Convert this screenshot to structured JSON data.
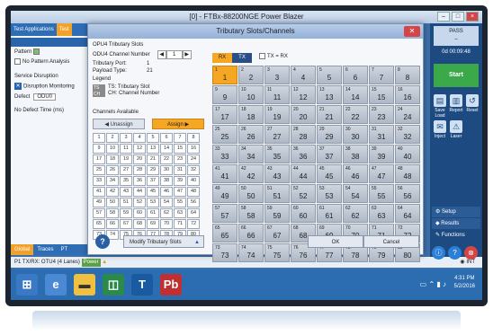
{
  "window_title": "[0] - FTBx-88200NGE Power Blazer",
  "left": {
    "tabs": [
      "Test Applications",
      "Test"
    ],
    "pattern_label": "Pattern",
    "no_pattern": "No Pattern Analysis",
    "service_disruption": "Service Disruption",
    "disruption_monitoring": "Disruption Monitoring",
    "defect_label": "Defect",
    "defect_value": "ODU0",
    "no_defect_time": "No Defect Time (ms)",
    "bottom_tabs": [
      "Global",
      "Traces",
      "PT"
    ]
  },
  "status": {
    "text": "P1 TX/RX: OTU4 (4 Lanes)",
    "power": "Power"
  },
  "right": {
    "pass": "PASS",
    "elapsed": "0d 00:09:48",
    "start": "Start",
    "icons": [
      "Save Load",
      "Report",
      "Reset",
      "Inject",
      "Laser"
    ],
    "menu": [
      "Setup",
      "Results",
      "Functions"
    ]
  },
  "taskbar": {
    "time": "4:31 PM",
    "date": "5/2/2016",
    "int": "INT"
  },
  "dialog": {
    "title": "Tributary Slots/Channels",
    "section": "OPU4 Tributary Slots",
    "odu4_label": "ODU4 Channel Number",
    "odu4_value": "1",
    "trib_port_label": "Tributary Port:",
    "trib_port_value": "1",
    "payload_label": "Payload Type:",
    "payload_value": "21",
    "legend_label": "Legend",
    "legend_ts": "TS: Tributary Slot",
    "legend_ch": "CH: Channel Number",
    "channels_available": "Channels Available",
    "unassign": "Unassign",
    "assign": "Assign",
    "rx_tab": "RX",
    "tx_tab": "TX",
    "tx_rx_label": "TX = RX",
    "modify": "Modify Tributary Slots",
    "ok": "OK",
    "cancel": "Cancel",
    "help": "?"
  },
  "available_channels": [
    1,
    2,
    3,
    4,
    5,
    6,
    7,
    8,
    9,
    10,
    11,
    12,
    13,
    14,
    15,
    16,
    17,
    18,
    19,
    20,
    21,
    22,
    23,
    24,
    25,
    26,
    27,
    28,
    29,
    30,
    31,
    32,
    33,
    34,
    35,
    36,
    37,
    38,
    39,
    40,
    41,
    42,
    43,
    44,
    45,
    46,
    47,
    48,
    49,
    50,
    51,
    52,
    53,
    54,
    55,
    56,
    57,
    58,
    59,
    60,
    61,
    62,
    63,
    64,
    65,
    66,
    67,
    68,
    69,
    70,
    71,
    72,
    73,
    74,
    75,
    76,
    77,
    78,
    79,
    80
  ],
  "slots": {
    "count": 80,
    "selected": 1
  }
}
